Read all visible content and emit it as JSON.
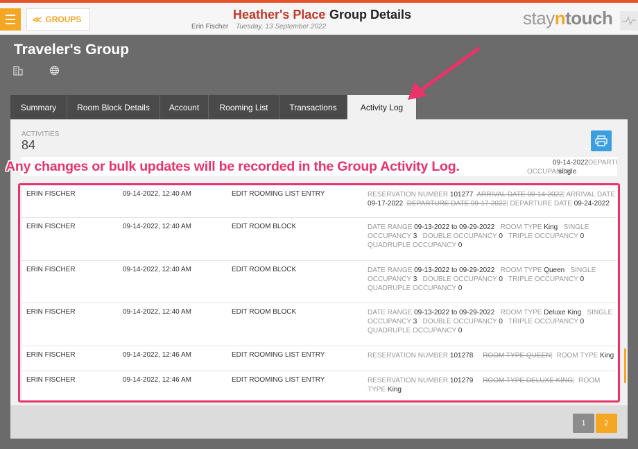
{
  "header": {
    "menu_icon": "hamburger-icon",
    "back_label": "GROUPS",
    "hotel_name": "Heather's Place",
    "page_title": "Group Details",
    "user_name": "Erin Fischer",
    "date": "Tuesday, 13 September 2022",
    "logo": {
      "part1": "stay",
      "part2": "n",
      "part3": "touch"
    },
    "accent_color": "#f5a623"
  },
  "group": {
    "name": "Traveler's Group",
    "icons": [
      "building-icon",
      "globe-icon"
    ]
  },
  "tabs": [
    {
      "label": "Summary",
      "active": false
    },
    {
      "label": "Room Block Details",
      "active": false
    },
    {
      "label": "Account",
      "active": false
    },
    {
      "label": "Rooming List",
      "active": false
    },
    {
      "label": "Transactions",
      "active": false
    },
    {
      "label": "Activity Log",
      "active": true
    }
  ],
  "activities": {
    "label": "ACTIVITIES",
    "count": "84",
    "print_icon": "print-icon"
  },
  "partial_row": {
    "date_fragment": "09-14-2022",
    "details_fragment": "DEPARTURE",
    "occupancy_key": "OCCUPANCY",
    "occupancy_value": "single"
  },
  "annotation": {
    "text": "Any changes or bulk updates will be recorded in the Group Activity Log.",
    "color": "#e8336b"
  },
  "log_rows": [
    {
      "user": "ERIN FISCHER",
      "time": "09-14-2022, 12:40 AM",
      "action": "EDIT ROOMING LIST ENTRY",
      "res_key": "RESERVATION NUMBER",
      "res_num": "101277",
      "old_arr": "ARRIVAL DATE 09-14-2022",
      "arr_key": "ARRIVAL DATE",
      "arr_val": "09-17-2022",
      "old_dep": "DEPARTURE DATE 09-17-2022",
      "dep_key": "DEPARTURE DATE",
      "dep_val": "09-24-2022"
    },
    {
      "user": "ERIN FISCHER",
      "time": "09-14-2022, 12:40 AM",
      "action": "EDIT ROOM BLOCK",
      "range_key": "DATE RANGE",
      "range_val": "09-13-2022 to 09-29-2022",
      "type_key": "ROOM TYPE",
      "type_val": "King",
      "single_key": "SINGLE OCCUPANCY",
      "single_val": "3",
      "double_key": "DOUBLE OCCUPANCY",
      "double_val": "0",
      "triple_key": "TRIPLE OCCUPANCY",
      "triple_val": "0",
      "quad_key": "QUADRUPLE OCCUPANCY",
      "quad_val": "0"
    },
    {
      "user": "ERIN FISCHER",
      "time": "09-14-2022, 12:40 AM",
      "action": "EDIT ROOM BLOCK",
      "range_key": "DATE RANGE",
      "range_val": "09-13-2022 to 09-29-2022",
      "type_key": "ROOM TYPE",
      "type_val": "Queen",
      "single_key": "SINGLE OCCUPANCY",
      "single_val": "3",
      "double_key": "DOUBLE OCCUPANCY",
      "double_val": "0",
      "triple_key": "TRIPLE OCCUPANCY",
      "triple_val": "0",
      "quad_key": "QUADRUPLE OCCUPANCY",
      "quad_val": "0"
    },
    {
      "user": "ERIN FISCHER",
      "time": "09-14-2022, 12:40 AM",
      "action": "EDIT ROOM BLOCK",
      "range_key": "DATE RANGE",
      "range_val": "09-13-2022 to 09-29-2022",
      "type_key": "ROOM TYPE",
      "type_val": "Deluxe King",
      "single_key": "SINGLE OCCUPANCY",
      "single_val": "3",
      "double_key": "DOUBLE OCCUPANCY",
      "double_val": "0",
      "triple_key": "TRIPLE OCCUPANCY",
      "triple_val": "0",
      "quad_key": "QUADRUPLE OCCUPANCY",
      "quad_val": "0"
    },
    {
      "user": "ERIN FISCHER",
      "time": "09-14-2022, 12:46 AM",
      "action": "EDIT ROOMING LIST ENTRY",
      "res_key": "RESERVATION NUMBER",
      "res_num": "101278",
      "old_type": "ROOM TYPE QUEEN",
      "type_key": "ROOM TYPE",
      "type_val": "King"
    },
    {
      "user": "ERIN FISCHER",
      "time": "09-14-2022, 12:46 AM",
      "action": "EDIT ROOMING LIST ENTRY",
      "res_key": "RESERVATION NUMBER",
      "res_num": "101279",
      "old_type": "ROOM TYPE DELUXE KING",
      "type_key": "ROOM TYPE",
      "type_val": "King"
    }
  ],
  "pagination": {
    "pages": [
      "1",
      "2"
    ],
    "current": "2"
  }
}
